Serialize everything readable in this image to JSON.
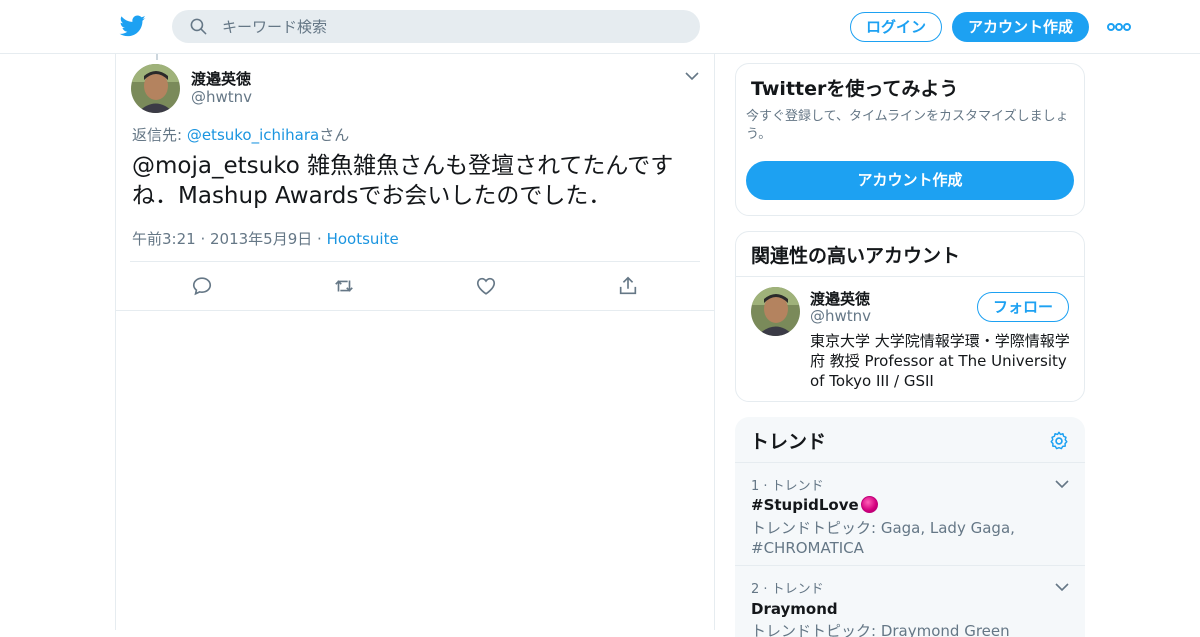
{
  "topbar": {
    "search_placeholder": "キーワード検索",
    "login_label": "ログイン",
    "signup_label": "アカウント作成"
  },
  "tweet": {
    "author_name": "渡邉英徳",
    "author_handle": "@hwtnv",
    "reply_prefix": "返信先: ",
    "reply_to": "@etsuko_ichihara",
    "reply_suffix": "さん",
    "text": "@moja_etsuko 雑魚雑魚さんも登壇されてたんですね．Mashup Awardsでお会いしたのでした．",
    "timestamp": "午前3:21 · 2013年5月9日",
    "separator": " · ",
    "source": "Hootsuite"
  },
  "signup_card": {
    "title": "Twitterを使ってみよう",
    "description": "今すぐ登録して、タイムラインをカスタマイズしましょう。",
    "button_label": "アカウント作成"
  },
  "related": {
    "title": "関連性の高いアカウント",
    "name": "渡邉英徳",
    "handle": "@hwtnv",
    "follow_label": "フォロー",
    "bio": "東京大学 大学院情報学環・学際情報学府 教授 Professor at The University of Tokyo III / GSII"
  },
  "trends": {
    "title": "トレンド",
    "items": [
      {
        "rank": "1 · トレンド",
        "name": "#StupidLove",
        "desc": "トレンドトピック: Gaga, Lady Gaga, #CHROMATICA"
      },
      {
        "rank": "2 · トレンド",
        "name": "Draymond",
        "desc": "トレンドトピック: Draymond Green"
      }
    ]
  },
  "colors": {
    "accent": "#1da1f2",
    "link": "#1b95e0",
    "muted": "#657786",
    "border": "#e6ecf0"
  },
  "icons": [
    "twitter-bird-icon",
    "search-icon",
    "more-dots-icon",
    "chevron-down-icon",
    "reply-icon",
    "retweet-icon",
    "like-icon",
    "share-icon",
    "settings-gear-icon"
  ]
}
